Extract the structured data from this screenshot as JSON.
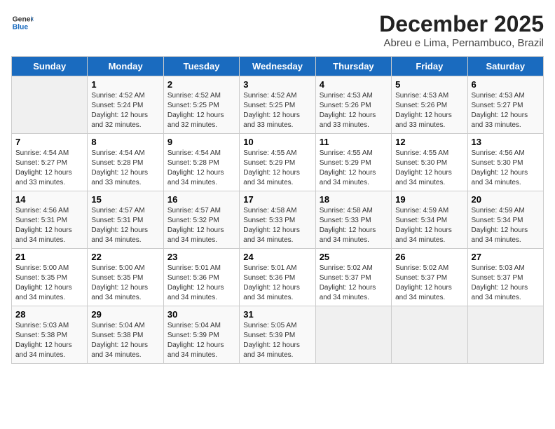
{
  "header": {
    "logo_line1": "General",
    "logo_line2": "Blue",
    "month": "December 2025",
    "location": "Abreu e Lima, Pernambuco, Brazil"
  },
  "days_of_week": [
    "Sunday",
    "Monday",
    "Tuesday",
    "Wednesday",
    "Thursday",
    "Friday",
    "Saturday"
  ],
  "weeks": [
    [
      {
        "day": "",
        "sunrise": "",
        "sunset": "",
        "daylight": ""
      },
      {
        "day": "1",
        "sunrise": "Sunrise: 4:52 AM",
        "sunset": "Sunset: 5:24 PM",
        "daylight": "Daylight: 12 hours and 32 minutes."
      },
      {
        "day": "2",
        "sunrise": "Sunrise: 4:52 AM",
        "sunset": "Sunset: 5:25 PM",
        "daylight": "Daylight: 12 hours and 32 minutes."
      },
      {
        "day": "3",
        "sunrise": "Sunrise: 4:52 AM",
        "sunset": "Sunset: 5:25 PM",
        "daylight": "Daylight: 12 hours and 33 minutes."
      },
      {
        "day": "4",
        "sunrise": "Sunrise: 4:53 AM",
        "sunset": "Sunset: 5:26 PM",
        "daylight": "Daylight: 12 hours and 33 minutes."
      },
      {
        "day": "5",
        "sunrise": "Sunrise: 4:53 AM",
        "sunset": "Sunset: 5:26 PM",
        "daylight": "Daylight: 12 hours and 33 minutes."
      },
      {
        "day": "6",
        "sunrise": "Sunrise: 4:53 AM",
        "sunset": "Sunset: 5:27 PM",
        "daylight": "Daylight: 12 hours and 33 minutes."
      }
    ],
    [
      {
        "day": "7",
        "sunrise": "Sunrise: 4:54 AM",
        "sunset": "Sunset: 5:27 PM",
        "daylight": "Daylight: 12 hours and 33 minutes."
      },
      {
        "day": "8",
        "sunrise": "Sunrise: 4:54 AM",
        "sunset": "Sunset: 5:28 PM",
        "daylight": "Daylight: 12 hours and 33 minutes."
      },
      {
        "day": "9",
        "sunrise": "Sunrise: 4:54 AM",
        "sunset": "Sunset: 5:28 PM",
        "daylight": "Daylight: 12 hours and 34 minutes."
      },
      {
        "day": "10",
        "sunrise": "Sunrise: 4:55 AM",
        "sunset": "Sunset: 5:29 PM",
        "daylight": "Daylight: 12 hours and 34 minutes."
      },
      {
        "day": "11",
        "sunrise": "Sunrise: 4:55 AM",
        "sunset": "Sunset: 5:29 PM",
        "daylight": "Daylight: 12 hours and 34 minutes."
      },
      {
        "day": "12",
        "sunrise": "Sunrise: 4:55 AM",
        "sunset": "Sunset: 5:30 PM",
        "daylight": "Daylight: 12 hours and 34 minutes."
      },
      {
        "day": "13",
        "sunrise": "Sunrise: 4:56 AM",
        "sunset": "Sunset: 5:30 PM",
        "daylight": "Daylight: 12 hours and 34 minutes."
      }
    ],
    [
      {
        "day": "14",
        "sunrise": "Sunrise: 4:56 AM",
        "sunset": "Sunset: 5:31 PM",
        "daylight": "Daylight: 12 hours and 34 minutes."
      },
      {
        "day": "15",
        "sunrise": "Sunrise: 4:57 AM",
        "sunset": "Sunset: 5:31 PM",
        "daylight": "Daylight: 12 hours and 34 minutes."
      },
      {
        "day": "16",
        "sunrise": "Sunrise: 4:57 AM",
        "sunset": "Sunset: 5:32 PM",
        "daylight": "Daylight: 12 hours and 34 minutes."
      },
      {
        "day": "17",
        "sunrise": "Sunrise: 4:58 AM",
        "sunset": "Sunset: 5:33 PM",
        "daylight": "Daylight: 12 hours and 34 minutes."
      },
      {
        "day": "18",
        "sunrise": "Sunrise: 4:58 AM",
        "sunset": "Sunset: 5:33 PM",
        "daylight": "Daylight: 12 hours and 34 minutes."
      },
      {
        "day": "19",
        "sunrise": "Sunrise: 4:59 AM",
        "sunset": "Sunset: 5:34 PM",
        "daylight": "Daylight: 12 hours and 34 minutes."
      },
      {
        "day": "20",
        "sunrise": "Sunrise: 4:59 AM",
        "sunset": "Sunset: 5:34 PM",
        "daylight": "Daylight: 12 hours and 34 minutes."
      }
    ],
    [
      {
        "day": "21",
        "sunrise": "Sunrise: 5:00 AM",
        "sunset": "Sunset: 5:35 PM",
        "daylight": "Daylight: 12 hours and 34 minutes."
      },
      {
        "day": "22",
        "sunrise": "Sunrise: 5:00 AM",
        "sunset": "Sunset: 5:35 PM",
        "daylight": "Daylight: 12 hours and 34 minutes."
      },
      {
        "day": "23",
        "sunrise": "Sunrise: 5:01 AM",
        "sunset": "Sunset: 5:36 PM",
        "daylight": "Daylight: 12 hours and 34 minutes."
      },
      {
        "day": "24",
        "sunrise": "Sunrise: 5:01 AM",
        "sunset": "Sunset: 5:36 PM",
        "daylight": "Daylight: 12 hours and 34 minutes."
      },
      {
        "day": "25",
        "sunrise": "Sunrise: 5:02 AM",
        "sunset": "Sunset: 5:37 PM",
        "daylight": "Daylight: 12 hours and 34 minutes."
      },
      {
        "day": "26",
        "sunrise": "Sunrise: 5:02 AM",
        "sunset": "Sunset: 5:37 PM",
        "daylight": "Daylight: 12 hours and 34 minutes."
      },
      {
        "day": "27",
        "sunrise": "Sunrise: 5:03 AM",
        "sunset": "Sunset: 5:37 PM",
        "daylight": "Daylight: 12 hours and 34 minutes."
      }
    ],
    [
      {
        "day": "28",
        "sunrise": "Sunrise: 5:03 AM",
        "sunset": "Sunset: 5:38 PM",
        "daylight": "Daylight: 12 hours and 34 minutes."
      },
      {
        "day": "29",
        "sunrise": "Sunrise: 5:04 AM",
        "sunset": "Sunset: 5:38 PM",
        "daylight": "Daylight: 12 hours and 34 minutes."
      },
      {
        "day": "30",
        "sunrise": "Sunrise: 5:04 AM",
        "sunset": "Sunset: 5:39 PM",
        "daylight": "Daylight: 12 hours and 34 minutes."
      },
      {
        "day": "31",
        "sunrise": "Sunrise: 5:05 AM",
        "sunset": "Sunset: 5:39 PM",
        "daylight": "Daylight: 12 hours and 34 minutes."
      },
      {
        "day": "",
        "sunrise": "",
        "sunset": "",
        "daylight": ""
      },
      {
        "day": "",
        "sunrise": "",
        "sunset": "",
        "daylight": ""
      },
      {
        "day": "",
        "sunrise": "",
        "sunset": "",
        "daylight": ""
      }
    ]
  ]
}
